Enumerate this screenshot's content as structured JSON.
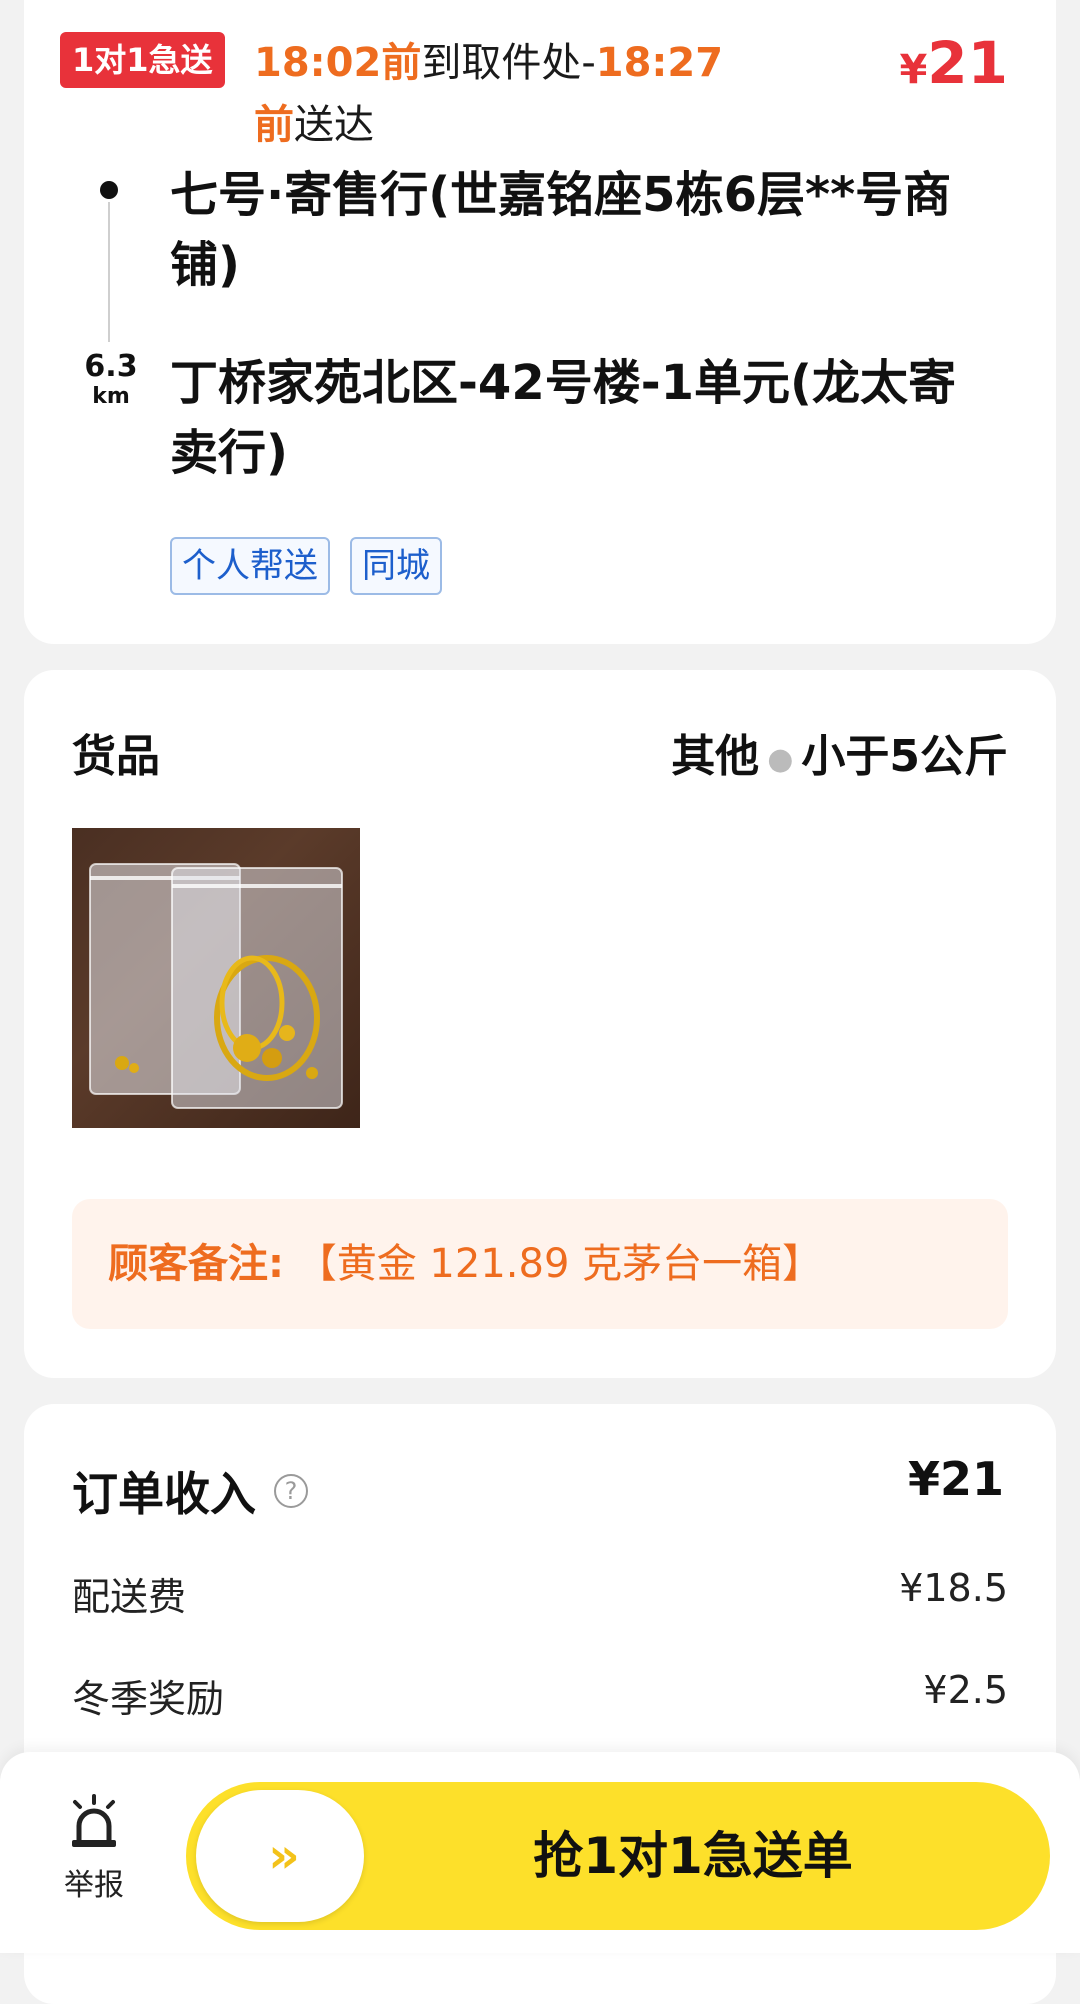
{
  "order": {
    "badge": "1对1急送",
    "pickup_time": "18:02前",
    "pickup_text": "到取件处-",
    "delivery_time": "18:27",
    "delivery_suffix_hl": "前",
    "delivery_suffix": "送达",
    "price_symbol": "¥",
    "price_value": "21",
    "distance_value": "6.3",
    "distance_unit": "km",
    "pickup_address": "七号·寄售行(世嘉铭座5栋6层**号商铺)",
    "dropoff_address": "丁桥家苑北区-42号楼-1单元(龙太寄卖行)",
    "tags": [
      "个人帮送",
      "同城"
    ]
  },
  "goods": {
    "title": "货品",
    "category": "其他",
    "weight": "小于5公斤",
    "photo_icon": "goods-photo",
    "remark_label": "顾客备注:",
    "remark_text": "【黄金 121.89 克茅台一箱】"
  },
  "income": {
    "title": "订单收入",
    "total": "¥21",
    "rows": [
      {
        "label": "配送费",
        "value": "¥18.5"
      },
      {
        "label": "冬季奖励",
        "value": "¥2.5"
      }
    ]
  },
  "bottom": {
    "report_label": "举报",
    "report_icon": "alarm-icon",
    "slider_icon": "double-chevron-right-icon",
    "slider_glyph": "››",
    "grab_label": "抢1对1急送单"
  },
  "colors": {
    "accent_orange": "#ee6c1f",
    "accent_red": "#e8323a",
    "tag_blue": "#1d5fcc",
    "button_yellow": "#fde02a"
  }
}
